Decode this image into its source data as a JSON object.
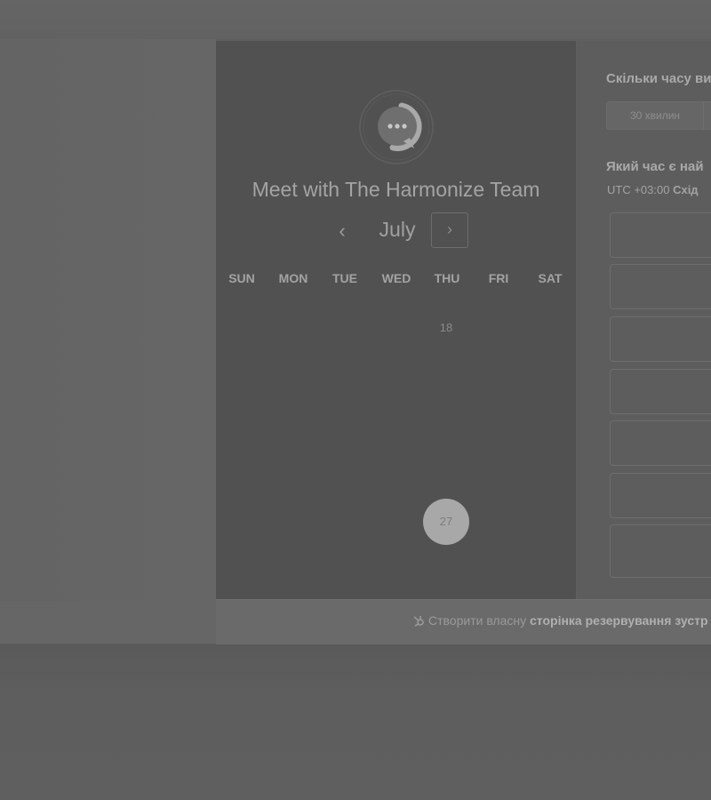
{
  "calendar": {
    "title": "Meet with The Harmonize Team",
    "month": "July",
    "prev_icon": "‹",
    "next_icon": "›",
    "weekdays": [
      "SUN",
      "MON",
      "TUE",
      "WED",
      "THU",
      "FRI",
      "SAT"
    ],
    "visible_days": [
      "18"
    ],
    "selected_day": "27"
  },
  "booking": {
    "duration_question": "Скільки часу ви",
    "duration_option": "30 хвилин",
    "time_question": "Який час є най",
    "timezone_prefix": "UTC +03:00",
    "timezone_name": "Схід"
  },
  "footer": {
    "text": "Створити власну",
    "link": "сторінка резервування зустр"
  }
}
